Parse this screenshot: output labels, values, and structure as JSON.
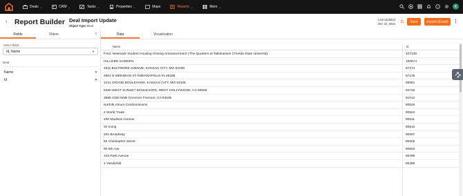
{
  "nav": {
    "items": [
      {
        "label": "Deals",
        "icon": "briefcase-icon",
        "dropdown": true
      },
      {
        "label": "CRM",
        "icon": "contacts-icon",
        "dropdown": true
      },
      {
        "label": "Tasks",
        "icon": "tasks-icon",
        "dropdown": true
      },
      {
        "label": "Properties",
        "icon": "building-icon",
        "dropdown": true
      },
      {
        "label": "Maps",
        "icon": "map-icon",
        "dropdown": false
      },
      {
        "label": "Reports",
        "icon": "reports-icon",
        "dropdown": true,
        "active": true
      },
      {
        "label": "More",
        "icon": "grid-icon",
        "dropdown": true
      }
    ],
    "avatar_initial": "K",
    "accent_color": "#ff7a2f"
  },
  "header": {
    "title": "Report Builder",
    "report_name": "Deal Import Update",
    "object_type_label": "Object Type:",
    "object_type_value": "Deal",
    "last_updated_label": "Last Updated",
    "last_updated_value": "Dec 10, 2024",
    "save_label": "Save",
    "export_label": "Export (Excel)"
  },
  "left": {
    "tabs": [
      "Fields",
      "Filters"
    ],
    "select_label": "Select fields",
    "select_value": "Id, Name",
    "group_label": "Deal",
    "fields": [
      "Name",
      "Id"
    ]
  },
  "right": {
    "tabs": [
      "Data",
      "Visualization"
    ],
    "columns": [
      "Name",
      "Id"
    ],
    "rows": [
      {
        "name": "Fred. Newmark Student Housing Closing Announcement | The Quarters at Tallahassee | Florida State University",
        "id": "107139"
      },
      {
        "name": "HILLSIDE GARDEN",
        "id": "100674"
      },
      {
        "name": "1511 BALTMORE AVENUE, KANSAS CITY, MO 64108",
        "id": "87174"
      },
      {
        "name": "2901 N MERIDIAN ST INDIANAPOLIS IN 46208",
        "id": "87135"
      },
      {
        "name": "1221 GRAND BOULEVARD, KANSAS CITY, MO 64106",
        "id": "86951"
      },
      {
        "name": "8480 WEST SUNSET BOULEVARD, WEST HOLLYWOOD, CA 90069",
        "id": "84746"
      },
      {
        "name": "3888 Artist Walk Common Fremont, CA 94536",
        "id": "81012"
      },
      {
        "name": "Norfolk Atrium Condominiums",
        "id": "80525"
      },
      {
        "name": "4 World Trade",
        "id": "80524"
      },
      {
        "name": "330 Madison Avenue",
        "id": "80511"
      },
      {
        "name": "33 Irving",
        "id": "80510"
      },
      {
        "name": "401 Broadway",
        "id": "80507"
      },
      {
        "name": "82 Christopher Street",
        "id": "80505"
      },
      {
        "name": "90 5th Ave",
        "id": "80504"
      },
      {
        "name": "425 Park Avenue",
        "id": "80498"
      },
      {
        "name": "1 Vanderbilt",
        "id": "80495"
      }
    ]
  }
}
